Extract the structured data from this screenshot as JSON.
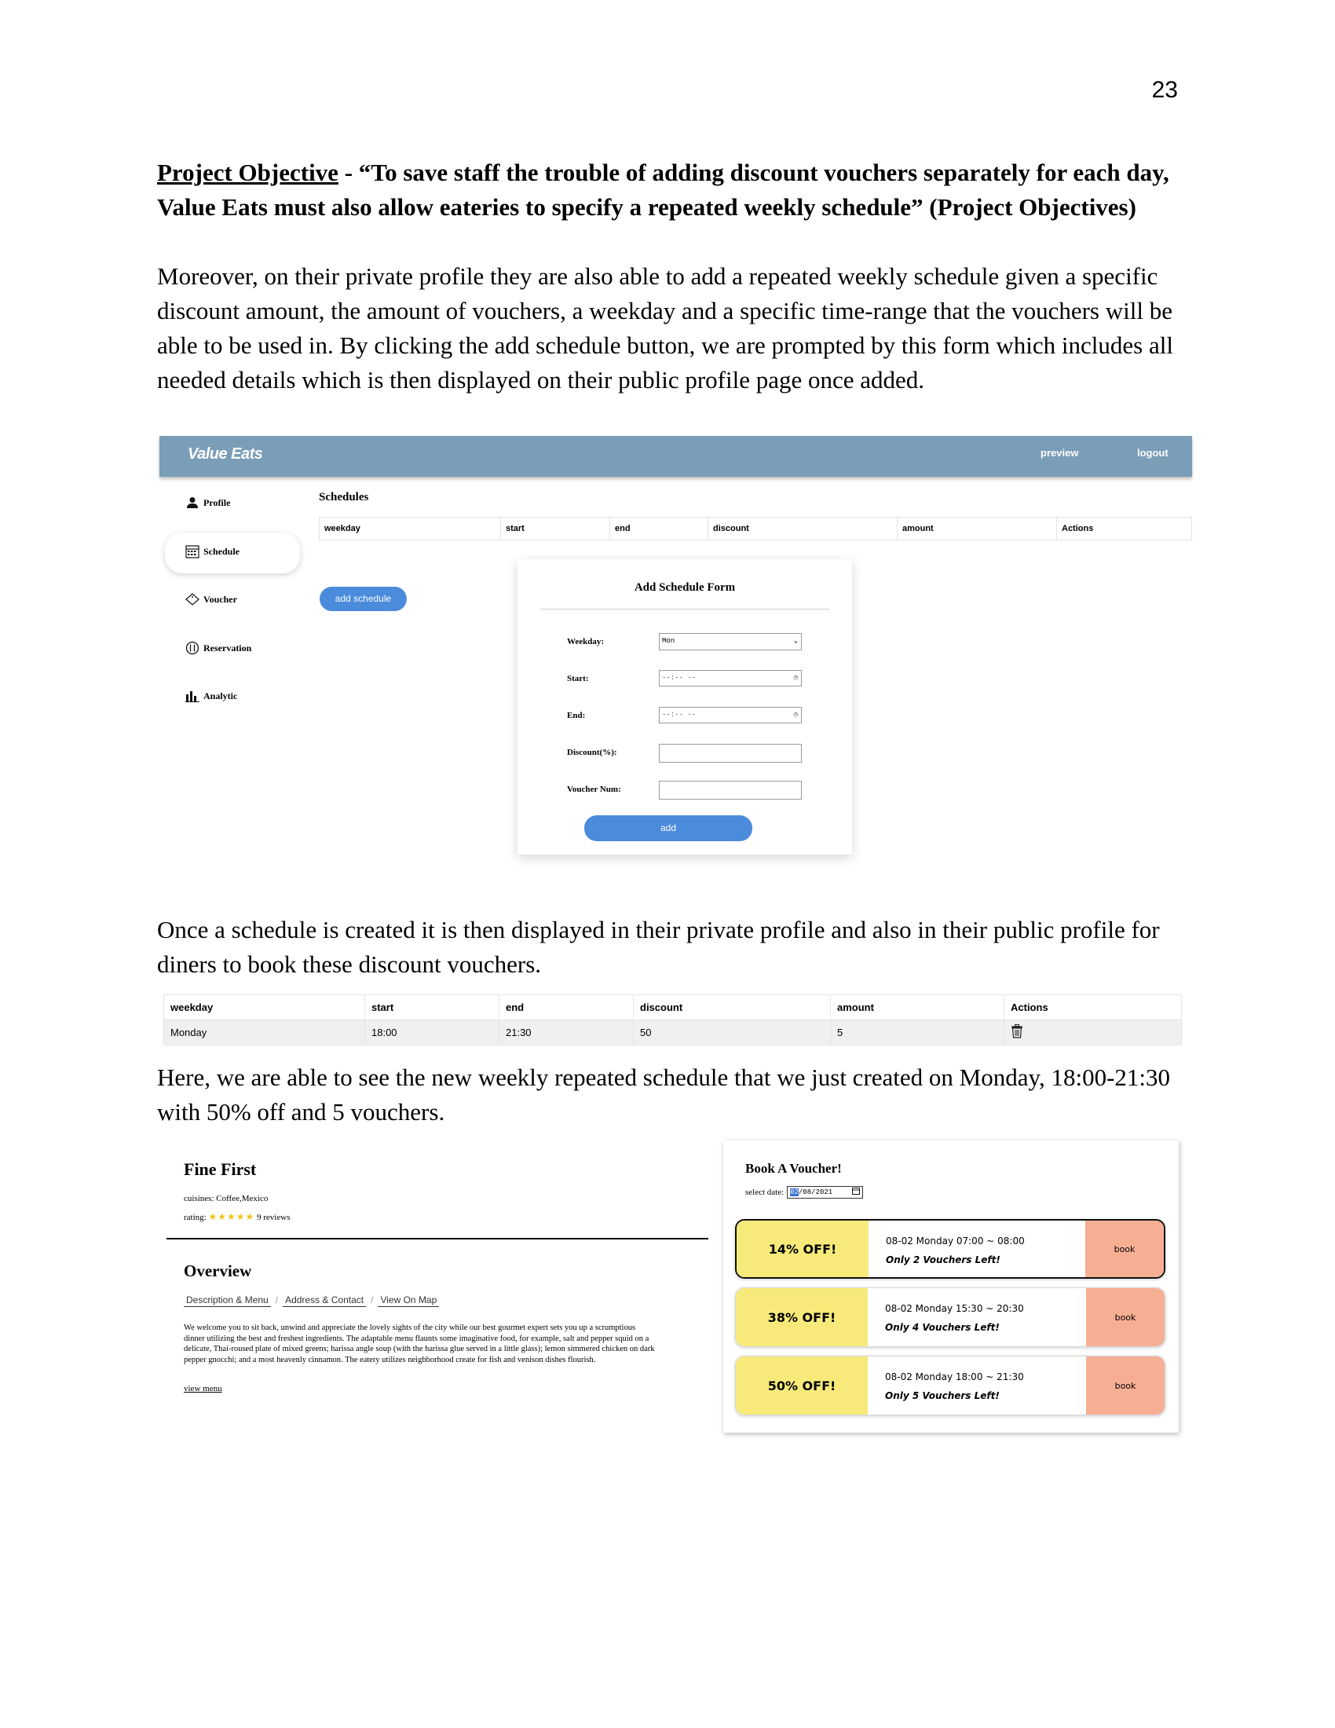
{
  "page_number": "23",
  "objective": {
    "label": "Project Objective",
    "quote": " - “To save staff the trouble of adding discount vouchers separately for each day, Value Eats must also allow eateries to specify a repeated weekly schedule” (Project Objectives)"
  },
  "paragraph1": "Moreover, on their private profile they are also able to add a repeated weekly schedule given a specific discount amount, the amount of vouchers, a weekday and a specific time-range that the vouchers will be able to be used in. By clicking the add schedule button, we are prompted by this form which includes all needed details which is then displayed on their public profile page once added.",
  "app": {
    "logo": "Value Eats",
    "nav": {
      "preview": "preview",
      "logout": "logout"
    },
    "sidebar": {
      "items": [
        {
          "label": "Profile",
          "icon": "person-icon"
        },
        {
          "label": "Schedule",
          "icon": "calendar-icon"
        },
        {
          "label": "Voucher",
          "icon": "ticket-icon"
        },
        {
          "label": "Reservation",
          "icon": "cutlery-icon"
        },
        {
          "label": "Analytic",
          "icon": "bar-chart-icon"
        }
      ]
    },
    "schedules_title": "Schedules",
    "table_headers": [
      "weekday",
      "start",
      "end",
      "discount",
      "amount",
      "Actions"
    ],
    "add_schedule_button": "add schedule",
    "form": {
      "title": "Add Schedule Form",
      "weekday_label": "Weekday:",
      "weekday_value": "Mon",
      "start_label": "Start:",
      "start_value": "--:-- --",
      "end_label": "End:",
      "end_value": "--:-- --",
      "discount_label": "Discount(%):",
      "voucher_label": "Voucher Num:",
      "add_button": "add"
    }
  },
  "paragraph2": "Once a schedule is created it is then displayed in their private profile and also in their public profile for diners to book these discount vouchers.",
  "result_table": {
    "headers": [
      "weekday",
      "start",
      "end",
      "discount",
      "amount",
      "Actions"
    ],
    "row": {
      "weekday": "Monday",
      "start": "18:00",
      "end": "21:30",
      "discount": "50",
      "amount": "5"
    }
  },
  "paragraph3": "Here, we are able to see the new weekly repeated schedule that we just created on Monday, 18:00-21:30 with 50% off and 5 vouchers.",
  "eatery": {
    "name": "Fine First",
    "cuisines": "cuisines: Coffee,Mexico",
    "rating_label": "rating:",
    "stars": "★★★★★",
    "reviews": "9 reviews",
    "overview_title": "Overview",
    "tabs": [
      "Description & Menu",
      "Address & Contact",
      "View On Map"
    ],
    "description": "We welcome you to sit back, unwind and appreciate the lovely sights of the city while our best gourmet expert sets you up a scrumptious dinner utilizing the best and freshest ingredients. The adaptable menu flaunts some imaginative food, for example, salt and pepper squid on a delicate, Thai-roused plate of mixed greens; harissa angle soup (with the harissa glue served in a little glass); lemon simmered chicken on dark pepper gnocchi; and a most heavenly cinnamon. The eatery utilizes neighborhood create for fish and venison dishes flourish.",
    "view_menu": "view menu"
  },
  "booking": {
    "title": "Book A Voucher!",
    "select_date_label": "select date:",
    "date_selected": "02",
    "date_rest": "/08/2021",
    "vouchers": [
      {
        "discount": "14% OFF!",
        "time": "08-02 Monday 07:00 ~ 08:00",
        "left": "Only 2 Vouchers Left!",
        "button": "book"
      },
      {
        "discount": "38% OFF!",
        "time": "08-02 Monday 15:30 ~ 20:30",
        "left": "Only 4 Vouchers Left!",
        "button": "book"
      },
      {
        "discount": "50% OFF!",
        "time": "08-02 Monday 18:00 ~ 21:30",
        "left": "Only 5 Vouchers Left!",
        "button": "book"
      }
    ]
  },
  "colors": {
    "topbar": "#7a9db8",
    "primary_button": "#4a8bdc",
    "voucher_discount": "#f7ea7a",
    "voucher_book": "#f7af94",
    "stars": "#f0c419"
  }
}
